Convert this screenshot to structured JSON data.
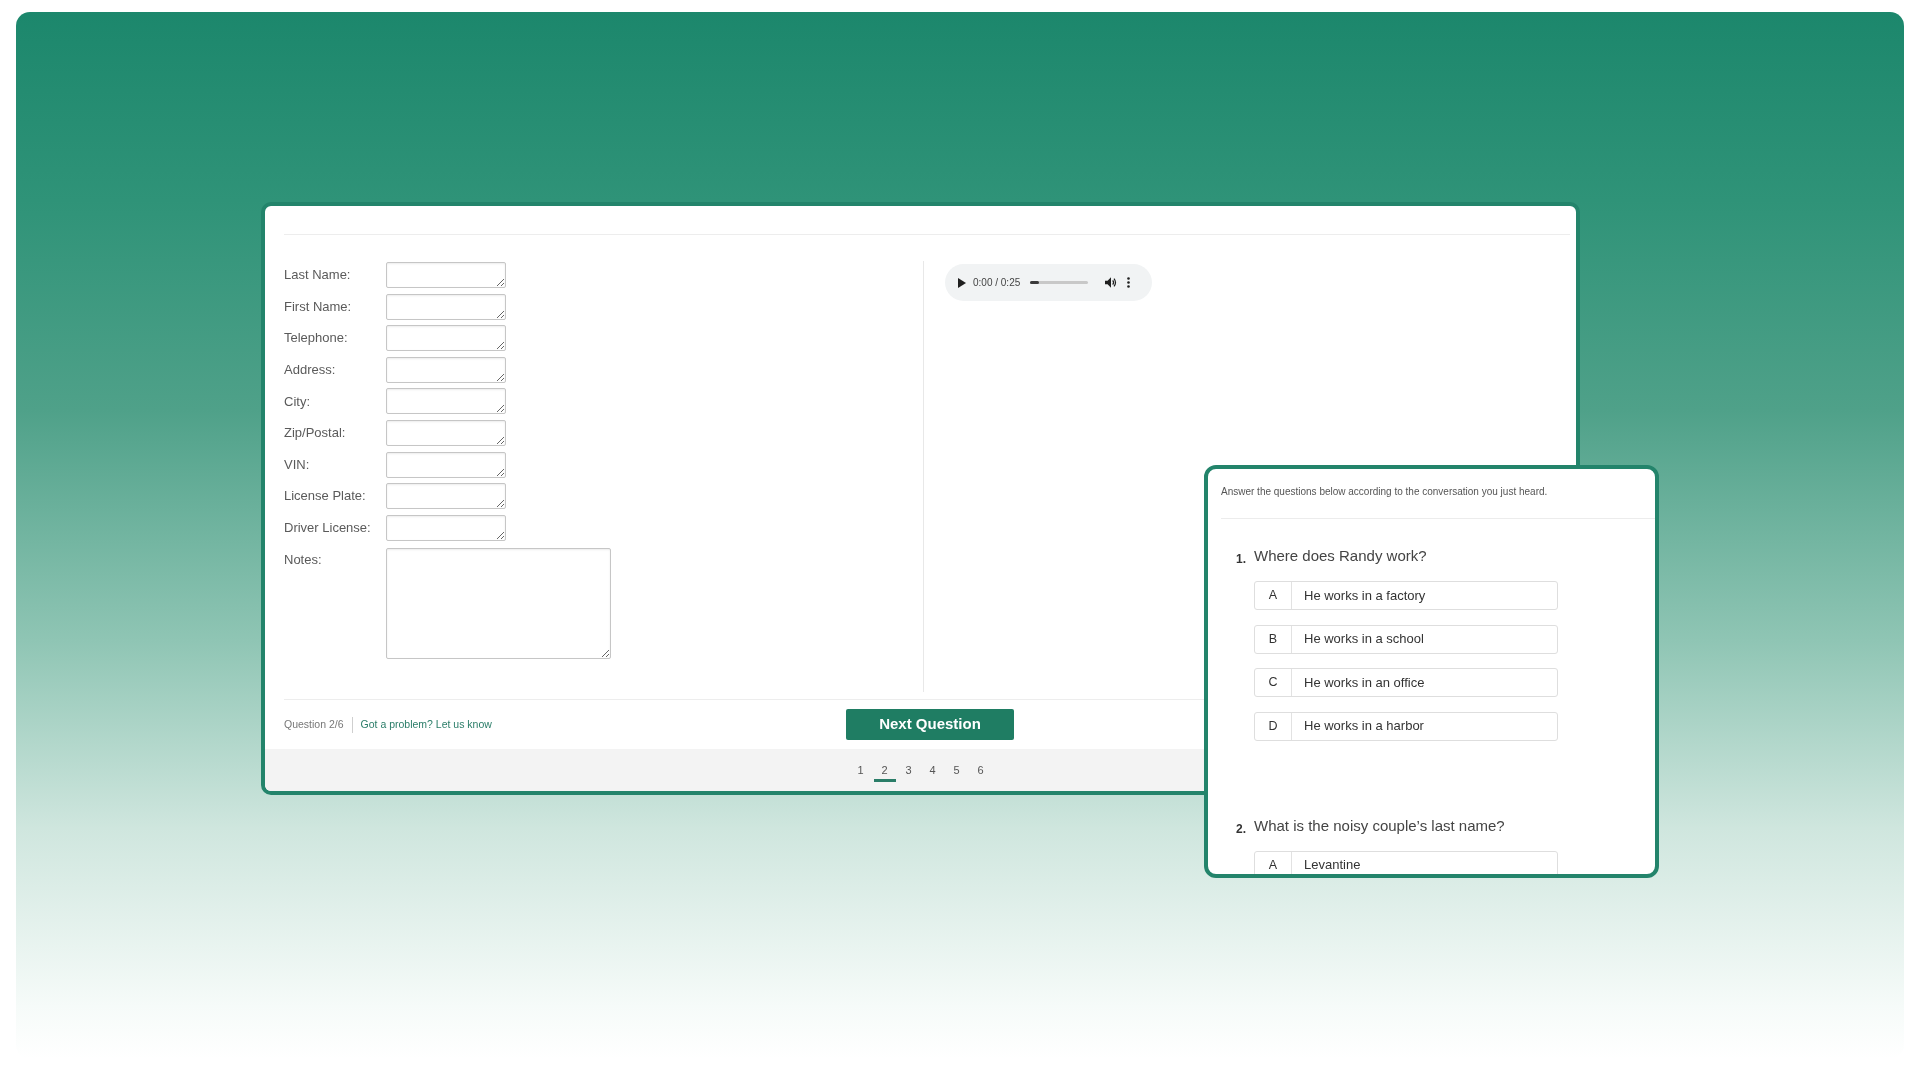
{
  "form": {
    "fields": [
      {
        "label": "Last Name:",
        "kind": "input"
      },
      {
        "label": "First Name:",
        "kind": "input"
      },
      {
        "label": "Telephone:",
        "kind": "input"
      },
      {
        "label": "Address:",
        "kind": "input"
      },
      {
        "label": "City:",
        "kind": "input"
      },
      {
        "label": "Zip/Postal:",
        "kind": "input"
      },
      {
        "label": "VIN:",
        "kind": "input"
      },
      {
        "label": "License Plate:",
        "kind": "input"
      },
      {
        "label": "Driver License:",
        "kind": "input"
      },
      {
        "label": "Notes:",
        "kind": "textarea"
      }
    ]
  },
  "audio_player": {
    "time": "0:00 / 0:25",
    "level": 0.15
  },
  "footer": {
    "progress": "Question 2/6",
    "help_link": "Got a problem? Let us know",
    "next_button": "Next Question"
  },
  "pagination": [
    {
      "label": "1",
      "selected": false
    },
    {
      "label": "2",
      "selected": true
    },
    {
      "label": "3",
      "selected": false
    },
    {
      "label": "4",
      "selected": false
    },
    {
      "label": "5",
      "selected": false
    },
    {
      "label": "6",
      "selected": false
    }
  ],
  "quiz_panel": {
    "instruction": "Answer the questions below according to the conversation you just heard.",
    "questions": [
      {
        "number": "1.",
        "text": "Where does Randy work?",
        "options": [
          {
            "letter": "A",
            "text": "He works in a factory"
          },
          {
            "letter": "B",
            "text": "He works in a school"
          },
          {
            "letter": "C",
            "text": "He works in an office"
          },
          {
            "letter": "D",
            "text": "He works in a harbor"
          }
        ]
      },
      {
        "number": "2.",
        "text": "What is the noisy couple’s last name?",
        "options": [
          {
            "letter": "A",
            "text": "Levantine"
          }
        ]
      }
    ]
  }
}
